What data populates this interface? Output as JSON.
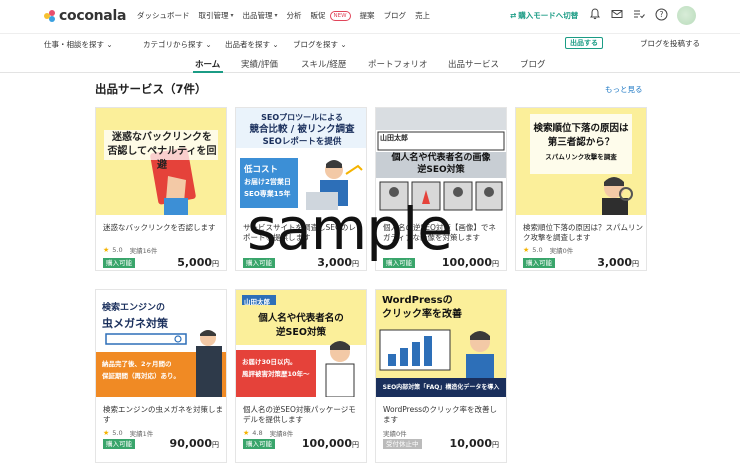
{
  "brand": {
    "name": "coconala"
  },
  "topnav": {
    "items": [
      {
        "label": "ダッシュボード",
        "has_menu": false
      },
      {
        "label": "取引管理",
        "has_menu": true
      },
      {
        "label": "出品管理",
        "has_menu": true
      },
      {
        "label": "分析",
        "has_menu": false
      },
      {
        "label": "販促",
        "has_menu": false,
        "badge": "NEW"
      },
      {
        "label": "提案",
        "has_menu": false
      },
      {
        "label": "ブログ",
        "has_menu": false
      },
      {
        "label": "売上",
        "has_menu": false
      }
    ],
    "mode_switch": "購入モードへ切替"
  },
  "subnav": {
    "items": [
      "仕事・相談を探す",
      "カテゴリから探す",
      "出品者を探す",
      "ブログを探す"
    ],
    "sell_button": "出品する",
    "post_blog": "ブログを投稿する"
  },
  "tabs": [
    "ホーム",
    "実績/評価",
    "スキル/経歴",
    "ポートフォリオ",
    "出品サービス",
    "ブログ"
  ],
  "section": {
    "title": "出品サービス（7件）",
    "more": "もっと見る"
  },
  "cards": [
    {
      "title": "迷惑なバックリンクを否認します",
      "rating": "5.0",
      "sales": "実績16件",
      "badge": "購入可能",
      "price": "5,000",
      "thumb_text": [
        "迷惑なバックリンクを",
        "否認してペナルティを回避"
      ]
    },
    {
      "title": "サービスサイトを調査しSEOのレポートを提供します",
      "rating": "",
      "sales": "",
      "badge": "購入可能",
      "price": "3,000",
      "thumb_text": [
        "SEOプロツールによる",
        "競合比較 / 被リンク調査",
        "SEOレポートを提供",
        "低コスト",
        "お届け2営業日",
        "SEO専業15年"
      ]
    },
    {
      "title": "個人名の逆SEO対策【画像】でネガティブな画像を対策します",
      "rating": "",
      "sales": "",
      "badge": "購入可能",
      "price": "100,000",
      "thumb_text": [
        "山田太郎",
        "個人名や代表者名の画像",
        "逆SEO対策"
      ]
    },
    {
      "title": "検索順位下落の原因は？スパムリンク攻撃を調査します",
      "rating": "5.0",
      "sales": "実績0件",
      "badge": "購入可能",
      "price": "3,000",
      "thumb_text": [
        "検索順位下落の原因は",
        "第三者認から？",
        "スパムリンク攻撃を調査"
      ]
    },
    {
      "title": "検索エンジンの虫メガネを対策します",
      "rating": "5.0",
      "sales": "実績1件",
      "badge": "購入可能",
      "price": "90,000",
      "thumb_text": [
        "検索エンジンの",
        "虫メガネ対策",
        "納品完了後、2ヶ月間の",
        "保証期間（再対応）あり。"
      ]
    },
    {
      "title": "個人名の逆SEO対策パッケージモデルを提供します",
      "rating": "4.8",
      "sales": "実績8件",
      "badge": "購入可能",
      "price": "100,000",
      "thumb_text": [
        "山田太郎",
        "個人名や代表者名の",
        "逆SEO対策",
        "お届け30日以内。",
        "風評被害対策歴10年～"
      ]
    },
    {
      "title": "WordPressのクリック率を改善します",
      "rating": "",
      "sales": "実績0件",
      "badge": "受付休止中",
      "price": "10,000",
      "thumb_text": [
        "WordPressの",
        "クリック率を改善",
        "SEO内部対策「FAQ」構造化データを導入"
      ]
    }
  ],
  "watermark": "sample",
  "colors": {
    "accent": "#1b9c85",
    "link": "#1b77c4",
    "badge": "#39a56b",
    "star": "#f5b300"
  }
}
